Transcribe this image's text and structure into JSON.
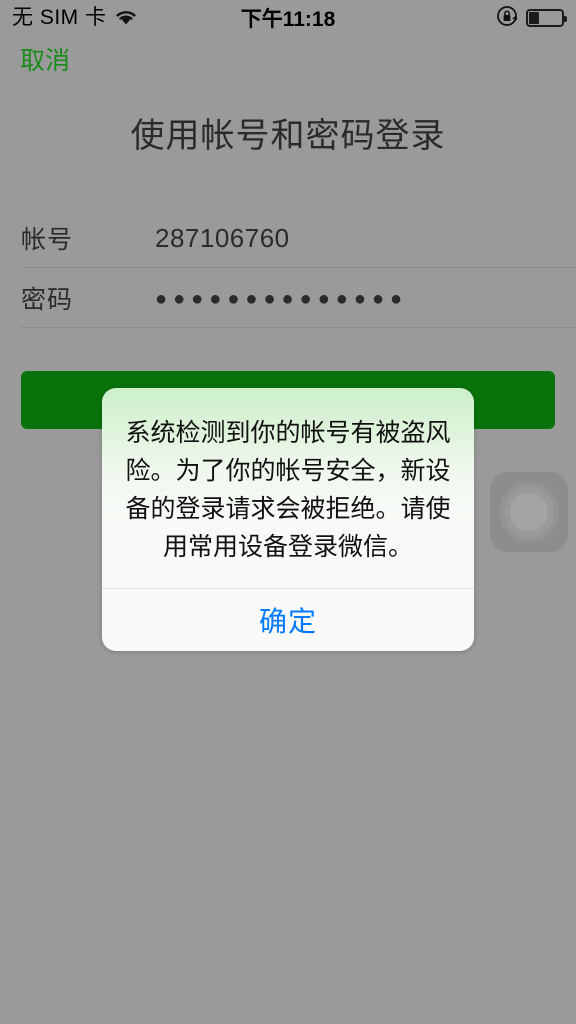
{
  "status_bar": {
    "carrier": "无 SIM 卡",
    "wifi_icon": "wifi-icon",
    "time": "下午11:18",
    "rotation_lock_icon": "rotation-lock-icon",
    "battery_icon": "battery-icon",
    "battery_level_percent": 30
  },
  "nav": {
    "cancel_label": "取消",
    "cancel_color": "#1a8c1a"
  },
  "page": {
    "title": "使用帐号和密码登录",
    "background_color": "#9a9a9a"
  },
  "form": {
    "fields": [
      {
        "label": "帐号",
        "value": "287106760",
        "masked": false
      },
      {
        "label": "密码",
        "value": "●●●●●●●●●●●●●●",
        "masked": true
      }
    ]
  },
  "login_button": {
    "label": "",
    "color": "#0a720a"
  },
  "assistive_touch": {
    "icon": "assistive-touch-icon"
  },
  "alert": {
    "message": "系统检测到你的帐号有被盗风险。为了你的帐号安全，新设备的登录请求会被拒绝。请使用常用设备登录微信。",
    "confirm_label": "确定",
    "confirm_color": "#007aff"
  }
}
